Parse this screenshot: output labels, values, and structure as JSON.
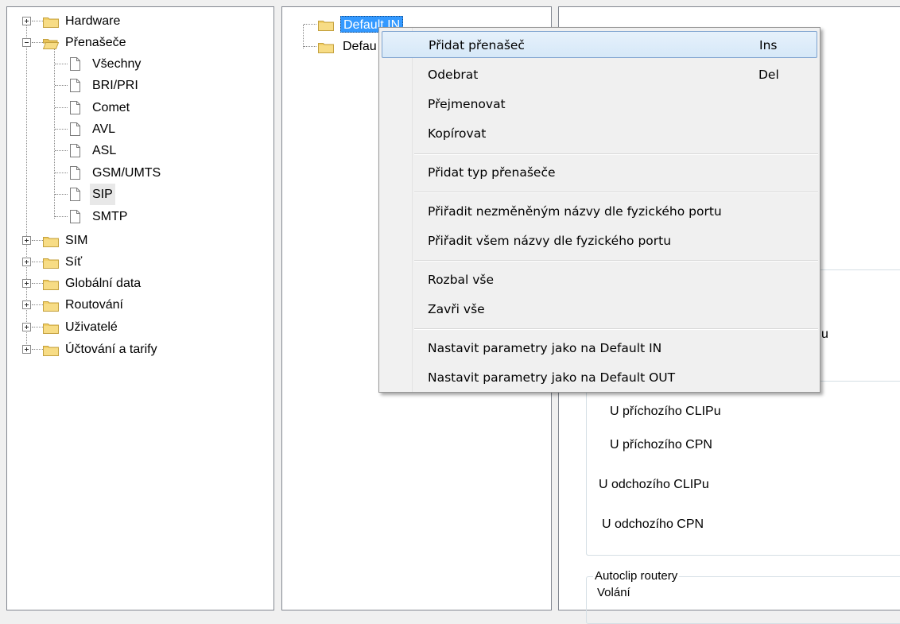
{
  "left_tree": {
    "hardware": "Hardware",
    "prenasece": "Přenašeče",
    "children": {
      "vsechny": "Všechny",
      "bri_pri": "BRI/PRI",
      "comet": "Comet",
      "avl": "AVL",
      "asl": "ASL",
      "gsm_umts": "GSM/UMTS",
      "sip": "SIP",
      "smtp": "SMTP"
    },
    "sim": "SIM",
    "sit": "Síť",
    "globalni_data": "Globální data",
    "routovani": "Routování",
    "uzivatele": "Uživatelé",
    "uctovani": "Účtování a tarify"
  },
  "mid_tree": {
    "default_in": "Default IN",
    "default_out_partial": "Defau"
  },
  "right_pane": {
    "partial_u": "u",
    "u_prichoziho_clipu": "U příchozího CLIPu",
    "u_prichoziho_cpn": "U příchozího CPN",
    "u_odchoziho_clipu": "U odchozího CLIPu",
    "u_odchoziho_cpn": "U odchozího CPN",
    "autoclip_title": "Autoclip routery",
    "volani": "Volání"
  },
  "context_menu": {
    "pridat_prenasec": "Přidat přenašeč",
    "pridat_shortcut": "Ins",
    "odebrat": "Odebrat",
    "odebrat_shortcut": "Del",
    "prejmenovat": "Přejmenovat",
    "kopirovat": "Kopírovat",
    "pridat_typ": "Přidat typ přenašeče",
    "priradit_nezmenenym": "Přiřadit nezměněným názvy dle fyzického portu",
    "priradit_vsem": "Přiřadit všem názvy dle fyzického portu",
    "rozbal_vse": "Rozbal vše",
    "zavri_vse": "Zavři vše",
    "nastavit_in": "Nastavit parametry jako na Default IN",
    "nastavit_out": "Nastavit parametry jako na Default OUT"
  },
  "colors": {
    "folder": "#f2cf66",
    "menu_highlight_border": "#7da2ce",
    "selection": "#3399ff"
  }
}
